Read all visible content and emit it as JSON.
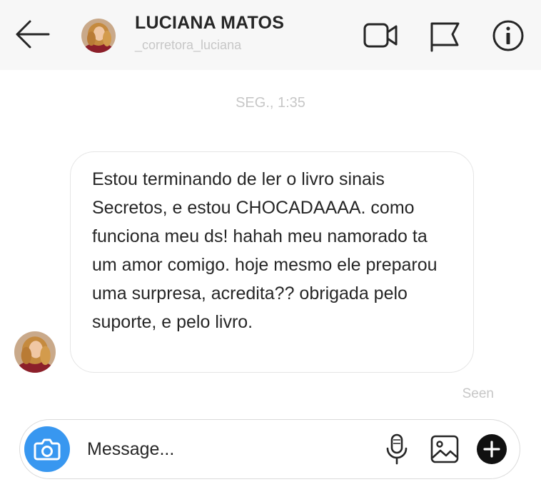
{
  "header": {
    "name": "LUCIANA MATOS",
    "username": "_corretora_luciana",
    "icons": {
      "back": "back-arrow-icon",
      "video": "video-camera-icon",
      "report": "flag-icon",
      "info": "info-icon"
    }
  },
  "thread": {
    "timestamp": "SEG., 1:35",
    "message": "Estou terminando de ler o livro sinais Secretos, e estou CHOCADAAAA. como funciona meu ds! hahah meu namorado ta um amor comigo. hoje mesmo ele preparou uma surpresa, acredita?? obrigada pelo suporte, e pelo livro.",
    "status": "Seen"
  },
  "composer": {
    "placeholder": "Message...",
    "icons": {
      "camera": "camera-icon",
      "mic": "microphone-icon",
      "gallery": "gallery-icon",
      "more": "plus-icon"
    }
  },
  "colors": {
    "accent": "#3897f0",
    "bubble_border": "#e5e5e5",
    "muted": "#c7c7c7",
    "header_bg": "#f7f7f7"
  }
}
